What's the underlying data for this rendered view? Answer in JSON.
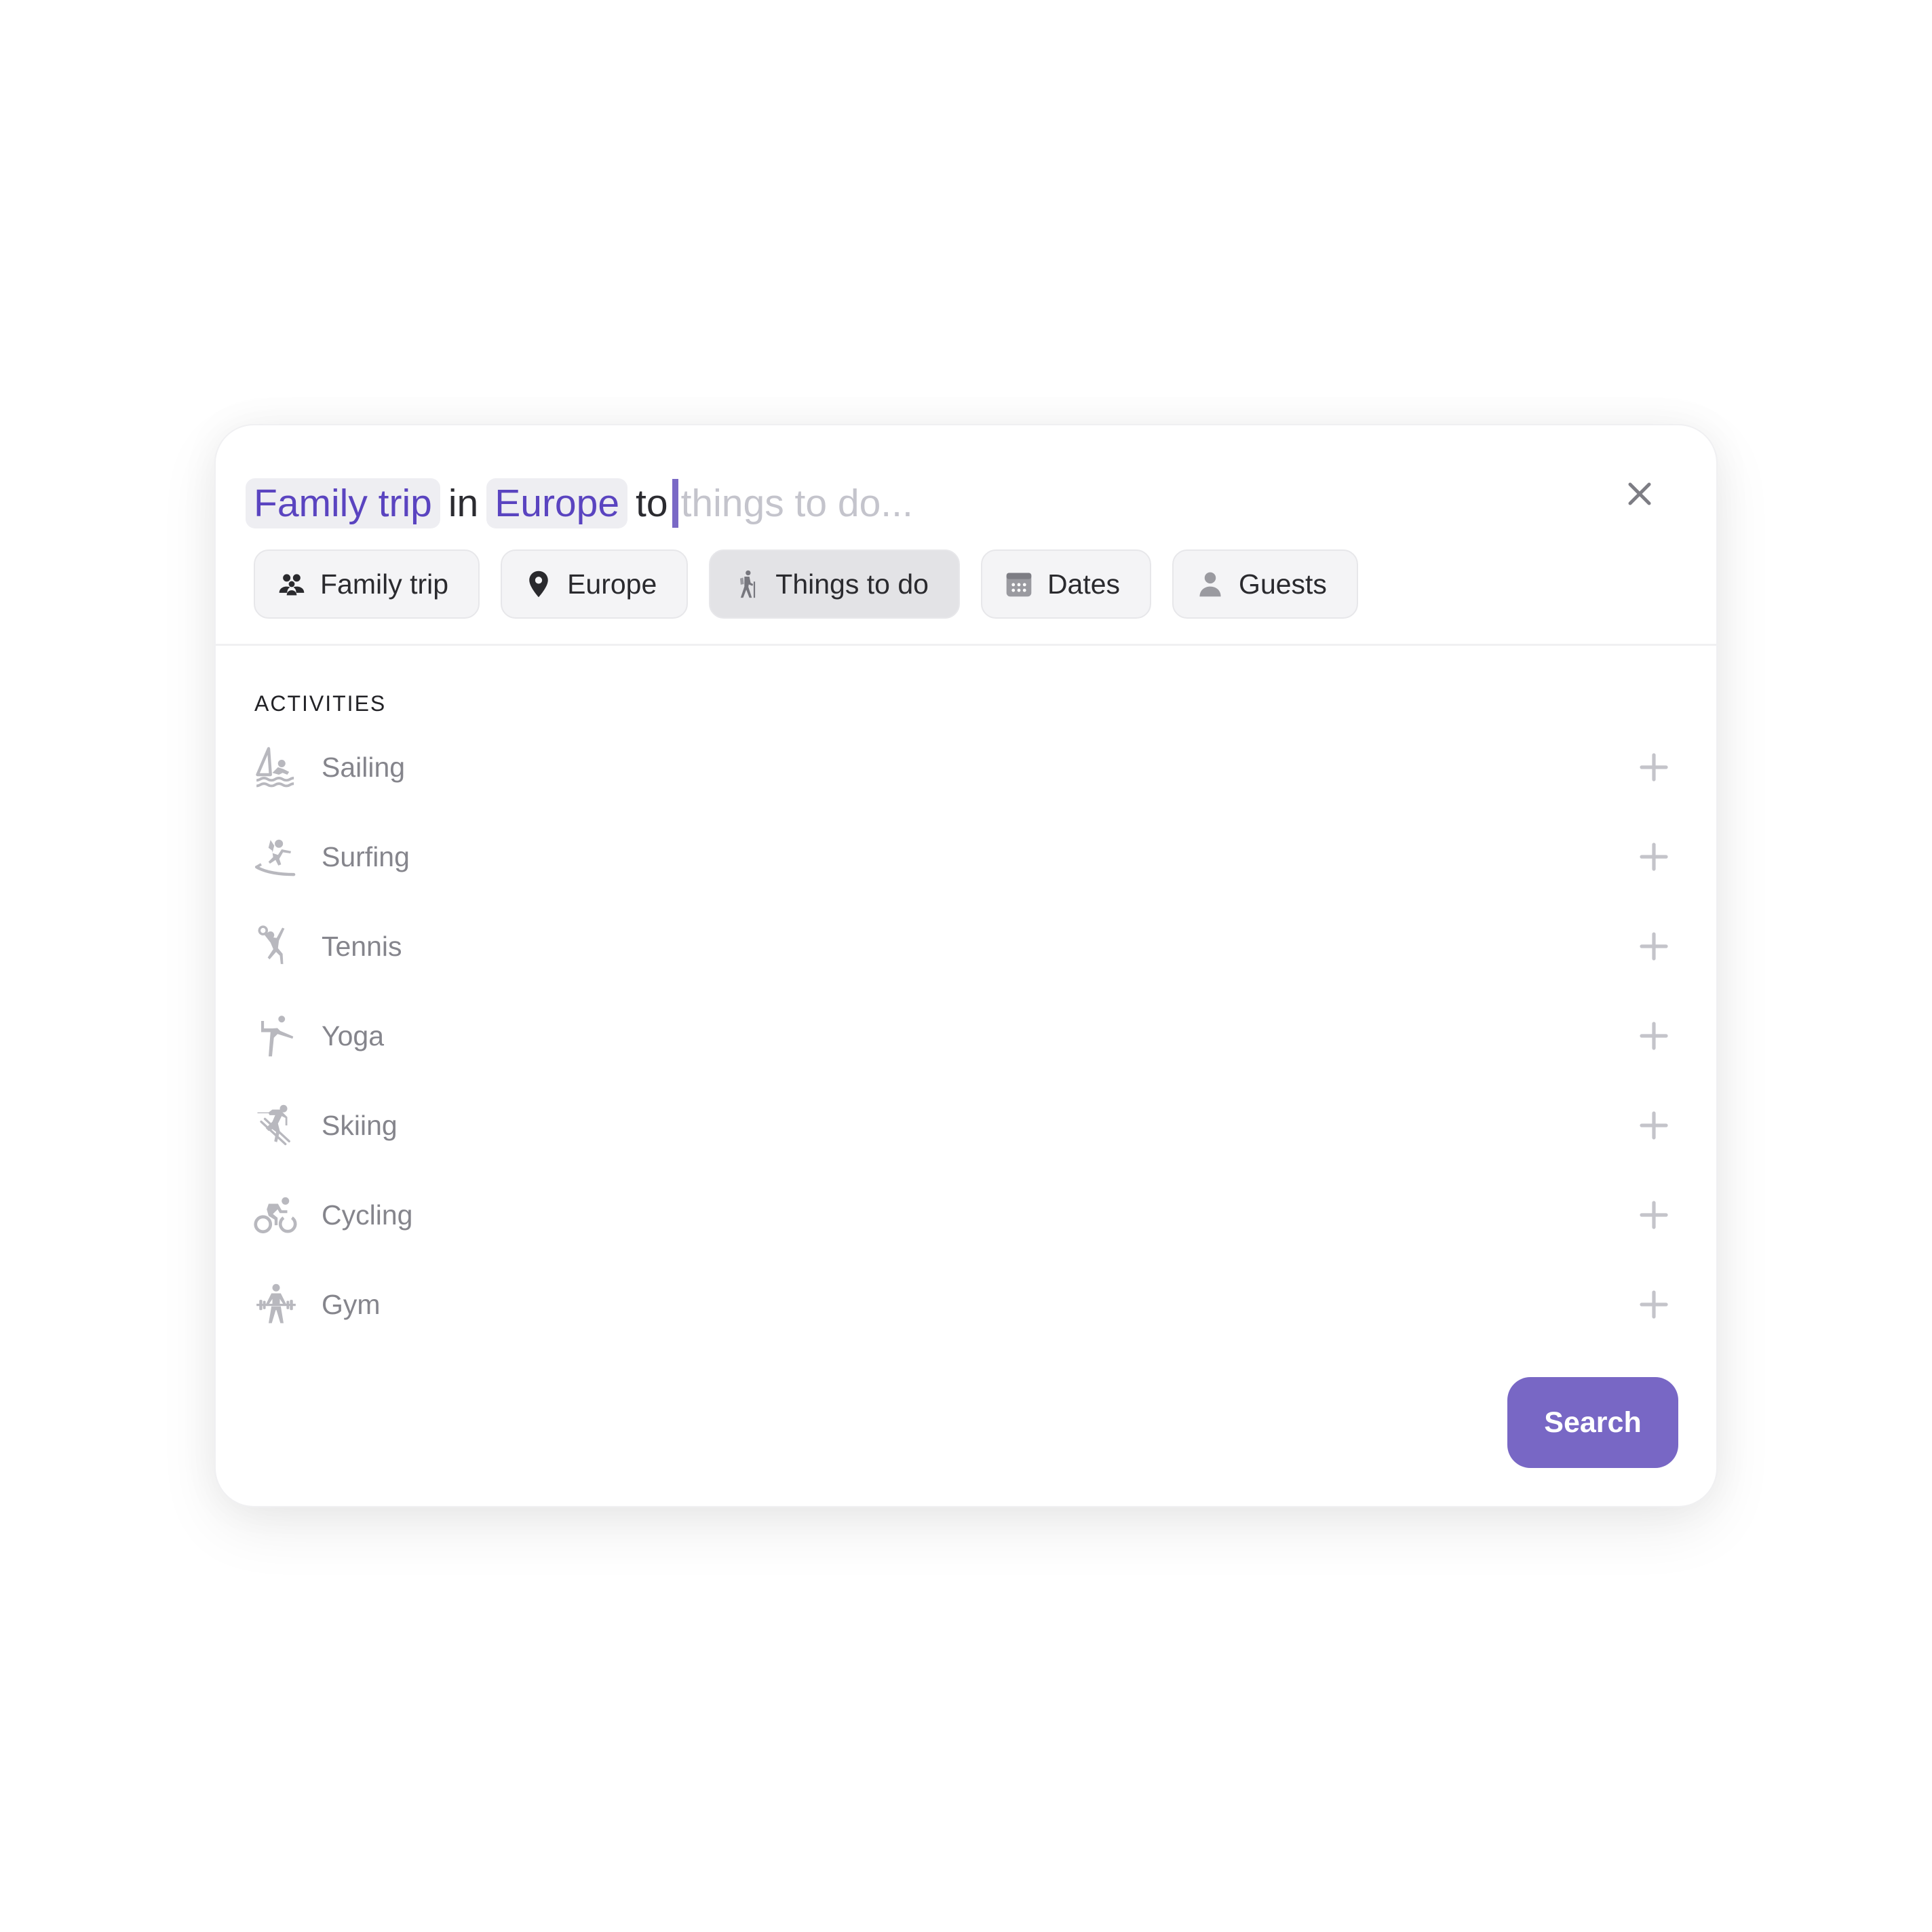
{
  "query": {
    "tokens": [
      "Family trip",
      "Europe"
    ],
    "connectors": [
      "in",
      "to"
    ],
    "placeholder": "things to do..."
  },
  "close_icon": "close-icon",
  "pills": [
    {
      "label": "Family trip",
      "icon": "family-icon",
      "active": false
    },
    {
      "label": "Europe",
      "icon": "location-pin-icon",
      "active": false
    },
    {
      "label": "Things to do",
      "icon": "hiking-icon",
      "active": true
    },
    {
      "label": "Dates",
      "icon": "calendar-icon",
      "active": false
    },
    {
      "label": "Guests",
      "icon": "person-icon",
      "active": false
    }
  ],
  "section": {
    "label": "ACTIVITIES"
  },
  "activities": [
    {
      "label": "Sailing",
      "icon": "sailing-icon"
    },
    {
      "label": "Surfing",
      "icon": "surfing-icon"
    },
    {
      "label": "Tennis",
      "icon": "tennis-icon"
    },
    {
      "label": "Yoga",
      "icon": "yoga-icon"
    },
    {
      "label": "Skiing",
      "icon": "skiing-icon"
    },
    {
      "label": "Cycling",
      "icon": "cycling-icon"
    },
    {
      "label": "Gym",
      "icon": "gym-icon"
    }
  ],
  "search_button": {
    "label": "Search"
  },
  "colors": {
    "accent": "#7867c5",
    "token_text": "#5a44c0",
    "token_bg": "#eeeef2",
    "icon_gray": "#b8b8be"
  }
}
